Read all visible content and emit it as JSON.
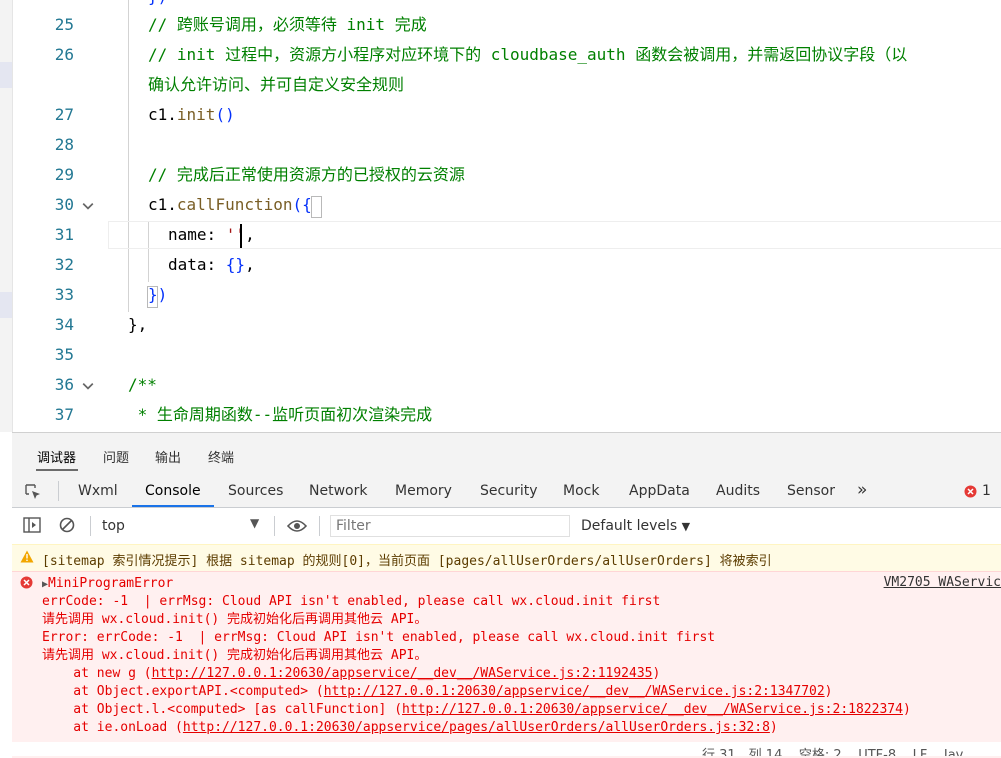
{
  "editor": {
    "lines": [
      {
        "num": "25",
        "comment": "// 跨账号调用，必须等待 init 完成"
      },
      {
        "num": "26",
        "comment": "// init 过程中，资源方小程序对应环境下的 cloudbase_auth 函数会被调用，并需返回协议字段（以",
        "comment_cont": "确认允许访问、并可自定义安全规则"
      },
      {
        "num": "27",
        "obj": "c1",
        "fn": "init",
        "parens": "()"
      },
      {
        "num": "28"
      },
      {
        "num": "29",
        "comment": "// 完成后正常使用资源方的已授权的云资源"
      },
      {
        "num": "30",
        "obj": "c1",
        "fn": "callFunction",
        "open": "({"
      },
      {
        "num": "31",
        "key": "name",
        "str": "''",
        "comma": ","
      },
      {
        "num": "32",
        "key": "data",
        "val": "{}",
        "comma": ","
      },
      {
        "num": "33",
        "close": "})"
      },
      {
        "num": "34",
        "text": "},"
      },
      {
        "num": "35"
      },
      {
        "num": "36",
        "comment": "/**"
      },
      {
        "num": "37",
        "comment": " * 生命周期函数--监听页面初次渲染完成"
      }
    ],
    "top_partial": "})"
  },
  "devtools": {
    "panel_tabs": [
      "调试器",
      "问题",
      "输出",
      "终端"
    ],
    "tool_tabs": [
      "Wxml",
      "Console",
      "Sources",
      "Network",
      "Memory",
      "Security",
      "Mock",
      "AppData",
      "Audits",
      "Sensor"
    ],
    "more": "»",
    "error_count": "1",
    "context": "top",
    "filter_placeholder": "Filter",
    "levels": "Default levels",
    "warning": "[sitemap 索引情况提示] 根据 sitemap 的规则[0]，当前页面 [pages/allUserOrders/allUserOrders] 将被索引",
    "error": {
      "title": "MiniProgramError",
      "source": "VM2705 WAServic",
      "lines": [
        "errCode: -1  | errMsg: Cloud API isn't enabled, please call wx.cloud.init first",
        "请先调用 wx.cloud.init() 完成初始化后再调用其他云 API。",
        "Error: errCode: -1  | errMsg: Cloud API isn't enabled, please call wx.cloud.init first",
        "请先调用 wx.cloud.init() 完成初始化后再调用其他云 API。"
      ],
      "stack": [
        {
          "prefix": "    at new g (",
          "url": "http://127.0.0.1:20630/appservice/__dev__/WAService.js:2:1192435",
          "suffix": ")"
        },
        {
          "prefix": "    at Object.exportAPI.<computed> (",
          "url": "http://127.0.0.1:20630/appservice/__dev__/WAService.js:2:1347702",
          "suffix": ")"
        },
        {
          "prefix": "    at Object.l.<computed> [as callFunction] (",
          "url": "http://127.0.0.1:20630/appservice/__dev__/WAService.js:2:1822374",
          "suffix": ")"
        },
        {
          "prefix": "    at ie.onLoad (",
          "url": "http://127.0.0.1:20630/appservice/pages/allUserOrders/allUserOrders.js:32:8",
          "suffix": ")"
        }
      ]
    }
  },
  "statusbar": {
    "text": "行 31，列 14    空格: 2    UTF-8    LF    Jav"
  },
  "colors": {
    "accent": "#1a73e8",
    "error": "#e50000",
    "warning_bg": "#fffbe5"
  }
}
